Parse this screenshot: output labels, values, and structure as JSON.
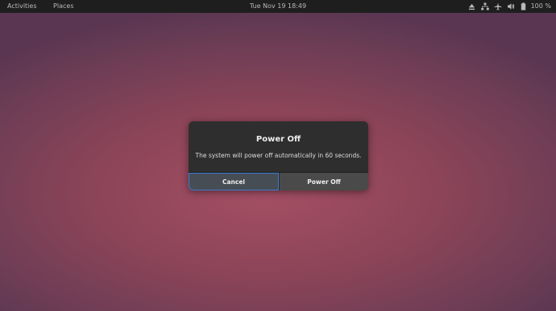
{
  "topbar": {
    "activities": "Activities",
    "places": "Places",
    "clock": "Tue Nov 19  18:49",
    "icons": [
      "eject-icon",
      "network-icon",
      "airplane-icon",
      "volume-icon",
      "battery-icon"
    ],
    "battery_percent": "100 %"
  },
  "dialog": {
    "title": "Power Off",
    "message": "The system will power off automatically in 60 seconds.",
    "cancel_label": "Cancel",
    "poweroff_label": "Power Off"
  },
  "colors": {
    "accent": "#3d7bd0",
    "dialog_bg": "#2e2e2e",
    "topbar_bg": "#1e1e1e"
  }
}
